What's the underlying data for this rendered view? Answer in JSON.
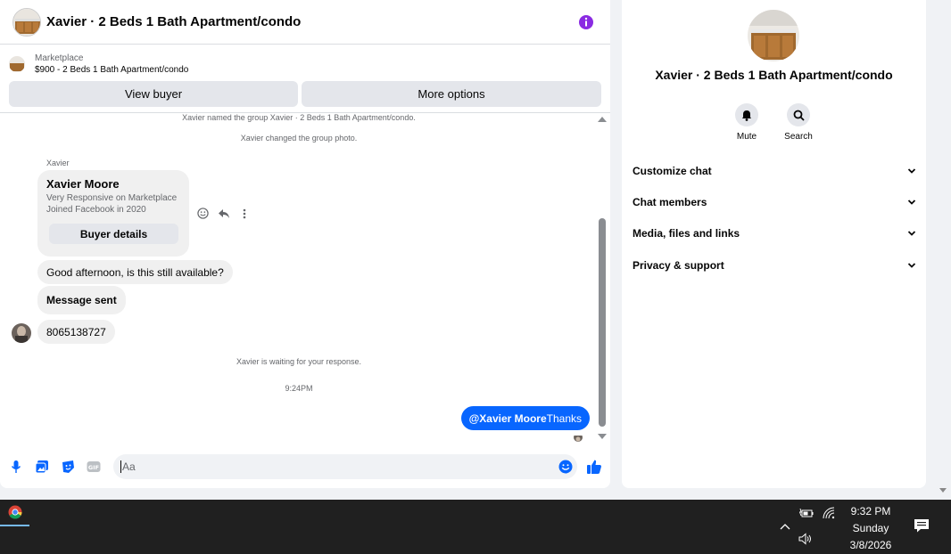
{
  "colors": {
    "accent": "#0866ff",
    "info": "#8a2be2",
    "taskbar": "#202020"
  },
  "chat": {
    "title": "Xavier · 2 Beds 1 Bath Apartment/condo",
    "marketplace_label": "Marketplace",
    "listing": "$900 - 2 Beds 1 Bath Apartment/condo",
    "view_buyer_label": "View buyer",
    "more_options_label": "More options"
  },
  "messages": {
    "system_1": "Xavier named the group Xavier · 2 Beds 1 Bath Apartment/condo.",
    "system_2": "Xavier changed the group photo.",
    "sender_name": "Xavier",
    "buyer_card": {
      "name": "Xavier Moore",
      "line1": "Very Responsive on Marketplace",
      "line2": "Joined Facebook in 2020",
      "button": "Buyer details"
    },
    "incoming_1": "Good afternoon, is this still available?",
    "incoming_2": "Message sent",
    "incoming_3": "8065138727",
    "waiting": "Xavier is waiting for your response.",
    "timestamp": "9:24PM",
    "outgoing_mention": "@Xavier Moore",
    "outgoing_text": "Thanks"
  },
  "composer": {
    "placeholder": "Aa"
  },
  "details": {
    "title": "Xavier · 2 Beds 1 Bath Apartment/condo",
    "mute_label": "Mute",
    "search_label": "Search",
    "sections": [
      "Customize chat",
      "Chat members",
      "Media, files and links",
      "Privacy & support"
    ]
  },
  "taskbar": {
    "time": "9:32 PM",
    "day": "Sunday",
    "date": "3/8/2026"
  },
  "icons": [
    "info-icon",
    "mic-icon",
    "photo-icon",
    "sticker-icon",
    "gif-icon",
    "emoji-icon",
    "thumbs-up-icon",
    "bell-icon",
    "search-icon",
    "chevron-down-icon",
    "react-icon",
    "reply-icon",
    "more-icon",
    "chrome-icon",
    "battery-icon",
    "wifi-icon",
    "volume-icon",
    "notification-icon"
  ]
}
